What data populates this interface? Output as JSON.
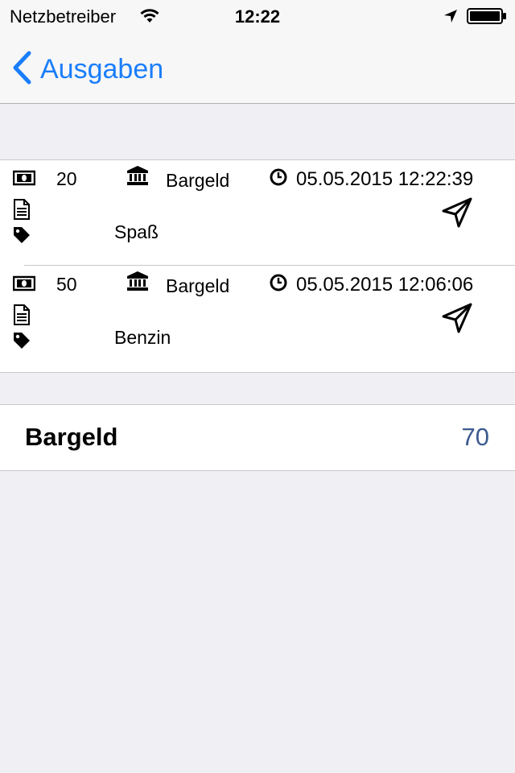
{
  "status_bar": {
    "carrier": "Netzbetreiber",
    "time": "12:22"
  },
  "nav": {
    "back_label": "Ausgaben"
  },
  "entries": [
    {
      "amount": "20",
      "account": "Bargeld",
      "datetime": "05.05.2015 12:22:39",
      "category": "Spaß"
    },
    {
      "amount": "50",
      "account": "Bargeld",
      "datetime": "05.05.2015 12:06:06",
      "category": "Benzin"
    }
  ],
  "summary": {
    "label": "Bargeld",
    "total": "70"
  },
  "colors": {
    "accent": "#1a7efb",
    "total_value": "#3b5a8f",
    "background": "#efeff4"
  }
}
